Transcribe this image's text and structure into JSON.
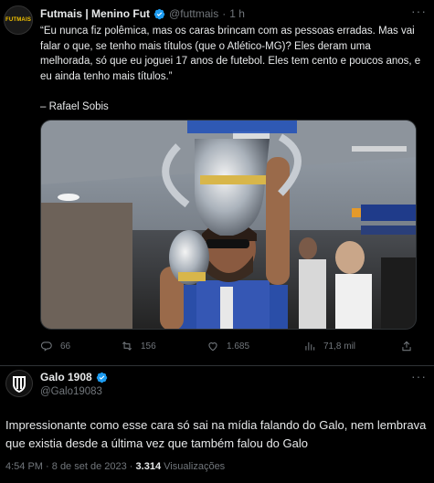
{
  "tweet1": {
    "avatar_text": "FUTMAIS",
    "name": "Futmais | Menino Fut",
    "handle": "@futtmais",
    "separator": "·",
    "time": "1 h",
    "more": "···",
    "text": "“Eu nunca fiz polêmica, mas os caras brincam com as pessoas erradas. Mas vai falar o que, se tenho mais títulos (que o Atlético-MG)? Eles deram uma melhorada, só que eu joguei 17 anos de futebol. Eles tem cento e poucos anos, e eu ainda tenho mais títulos.”\n\n– Rafael Sobis",
    "actions": {
      "replies": "66",
      "retweets": "156",
      "likes": "1.685",
      "views": "71,8 mil"
    }
  },
  "tweet2": {
    "name": "Galo 1908",
    "handle": "@Galo19083",
    "more": "···",
    "text": "Impressionante como esse cara só sai na mídia falando do Galo, nem lembrava que existia desde a última vez que também falou do Galo",
    "time": "4:54 PM",
    "date": "8 de set de 2023",
    "separator": "·",
    "views_count": "3.314",
    "views_label": "Visualizações"
  },
  "colors": {
    "background": "#000000",
    "text": "#e7e9ea",
    "muted": "#71767b",
    "verified": "#1d9bf0",
    "divider": "#2f3336"
  }
}
